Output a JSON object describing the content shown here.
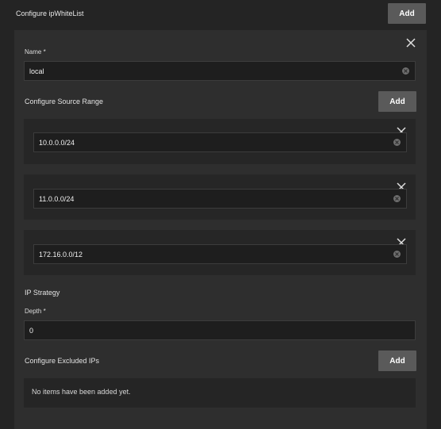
{
  "header": {
    "title": "Configure ipWhiteList",
    "add_label": "Add"
  },
  "form": {
    "name": {
      "label": "Name *",
      "value": "local"
    },
    "source_range": {
      "title": "Configure Source Range",
      "add_label": "Add",
      "items": [
        "10.0.0.0/24",
        "11.0.0.0/24",
        "172.16.0.0/12"
      ]
    },
    "ip_strategy": {
      "title": "IP Strategy",
      "depth": {
        "label": "Depth *",
        "value": "0"
      }
    },
    "excluded_ips": {
      "title": "Configure Excluded IPs",
      "add_label": "Add",
      "empty_text": "No items have been added yet."
    }
  },
  "icons": {
    "close": "close-icon",
    "clear": "clear-input-icon"
  }
}
